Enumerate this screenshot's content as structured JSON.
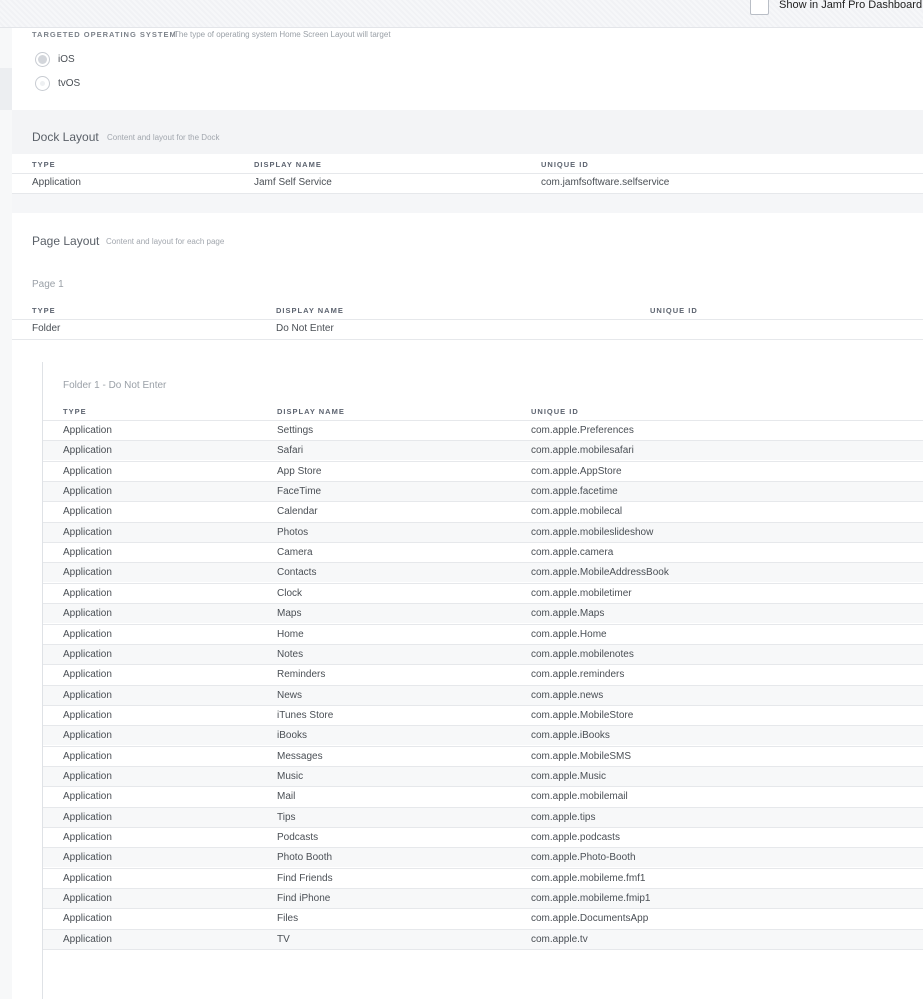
{
  "header": {
    "dashboard_label": "Show in Jamf Pro Dashboard"
  },
  "os_section": {
    "label": "TARGETED OPERATING SYSTEM",
    "description": "The type of operating system Home Screen Layout will target",
    "options": [
      {
        "label": "iOS",
        "selected": true
      },
      {
        "label": "tvOS",
        "selected": false
      }
    ]
  },
  "dock": {
    "title": "Dock Layout",
    "description": "Content and layout for the Dock",
    "columns": [
      "TYPE",
      "DISPLAY NAME",
      "UNIQUE ID"
    ],
    "rows": [
      {
        "type": "Application",
        "name": "Jamf Self Service",
        "id": "com.jamfsoftware.selfservice"
      }
    ]
  },
  "page_layout": {
    "title": "Page Layout",
    "description": "Content and layout for each page",
    "page_label": "Page 1",
    "columns": [
      "TYPE",
      "DISPLAY NAME",
      "UNIQUE ID"
    ],
    "rows": [
      {
        "type": "Folder",
        "name": "Do Not Enter",
        "id": ""
      }
    ],
    "folder": {
      "title": "Folder 1 - Do Not Enter",
      "columns": [
        "TYPE",
        "DISPLAY NAME",
        "UNIQUE ID"
      ],
      "rows": [
        {
          "type": "Application",
          "name": "Settings",
          "id": "com.apple.Preferences"
        },
        {
          "type": "Application",
          "name": "Safari",
          "id": "com.apple.mobilesafari"
        },
        {
          "type": "Application",
          "name": "App Store",
          "id": "com.apple.AppStore"
        },
        {
          "type": "Application",
          "name": "FaceTime",
          "id": "com.apple.facetime"
        },
        {
          "type": "Application",
          "name": "Calendar",
          "id": "com.apple.mobilecal"
        },
        {
          "type": "Application",
          "name": "Photos",
          "id": "com.apple.mobileslideshow"
        },
        {
          "type": "Application",
          "name": "Camera",
          "id": "com.apple.camera"
        },
        {
          "type": "Application",
          "name": "Contacts",
          "id": "com.apple.MobileAddressBook"
        },
        {
          "type": "Application",
          "name": "Clock",
          "id": "com.apple.mobiletimer"
        },
        {
          "type": "Application",
          "name": "Maps",
          "id": "com.apple.Maps"
        },
        {
          "type": "Application",
          "name": "Home",
          "id": "com.apple.Home"
        },
        {
          "type": "Application",
          "name": "Notes",
          "id": "com.apple.mobilenotes"
        },
        {
          "type": "Application",
          "name": "Reminders",
          "id": "com.apple.reminders"
        },
        {
          "type": "Application",
          "name": "News",
          "id": "com.apple.news"
        },
        {
          "type": "Application",
          "name": "iTunes Store",
          "id": "com.apple.MobileStore"
        },
        {
          "type": "Application",
          "name": "iBooks",
          "id": "com.apple.iBooks"
        },
        {
          "type": "Application",
          "name": "Messages",
          "id": "com.apple.MobileSMS"
        },
        {
          "type": "Application",
          "name": "Music",
          "id": "com.apple.Music"
        },
        {
          "type": "Application",
          "name": "Mail",
          "id": "com.apple.mobilemail"
        },
        {
          "type": "Application",
          "name": "Tips",
          "id": "com.apple.tips"
        },
        {
          "type": "Application",
          "name": "Podcasts",
          "id": "com.apple.podcasts"
        },
        {
          "type": "Application",
          "name": "Photo Booth",
          "id": "com.apple.Photo-Booth"
        },
        {
          "type": "Application",
          "name": "Find Friends",
          "id": "com.apple.mobileme.fmf1"
        },
        {
          "type": "Application",
          "name": "Find iPhone",
          "id": "com.apple.mobileme.fmip1"
        },
        {
          "type": "Application",
          "name": "Files",
          "id": "com.apple.DocumentsApp"
        },
        {
          "type": "Application",
          "name": "TV",
          "id": "com.apple.tv"
        }
      ]
    }
  }
}
